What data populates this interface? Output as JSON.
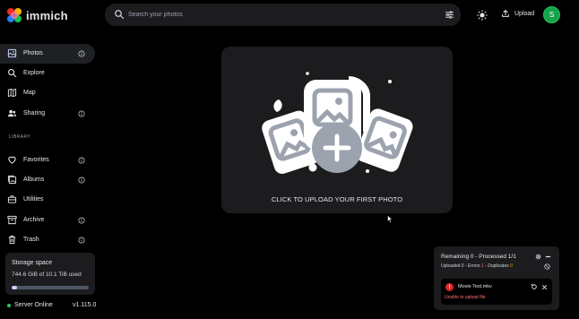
{
  "app": {
    "name": "immich"
  },
  "header": {
    "search_placeholder": "Search your photos",
    "upload_label": "Upload",
    "avatar_initial": "S"
  },
  "sidebar": {
    "items": [
      {
        "label": "Photos",
        "icon": "photos-icon",
        "active": true,
        "info": true
      },
      {
        "label": "Explore",
        "icon": "explore-icon",
        "active": false,
        "info": false
      },
      {
        "label": "Map",
        "icon": "map-icon",
        "active": false,
        "info": false
      },
      {
        "label": "Sharing",
        "icon": "sharing-icon",
        "active": false,
        "info": true
      }
    ],
    "library_label": "LIBRARY",
    "library_items": [
      {
        "label": "Favorites",
        "icon": "heart-icon",
        "info": true
      },
      {
        "label": "Albums",
        "icon": "albums-icon",
        "info": true
      },
      {
        "label": "Utilities",
        "icon": "utilities-icon",
        "info": false
      },
      {
        "label": "Archive",
        "icon": "archive-icon",
        "info": true
      },
      {
        "label": "Trash",
        "icon": "trash-icon",
        "info": true
      }
    ],
    "storage": {
      "title": "Storage space",
      "used_text": "744.6 GiB of 10.1 TiB used",
      "used_fraction": 0.072
    },
    "server": {
      "status": "Server Online",
      "version": "v1.115.0"
    }
  },
  "main": {
    "empty_text": "CLICK TO UPLOAD YOUR FIRST PHOTO"
  },
  "upload_panel": {
    "title": "Remaining 0 - Processed 1/1",
    "uploaded_label": "Uploaded 0 - Errors ",
    "errors_count": "1",
    "duplicates_label": " - Duplicates ",
    "duplicates_count": "0",
    "file": {
      "name": "Movie Test.mkv",
      "error": "Unable to upload file"
    }
  },
  "colors": {
    "background": "#000000",
    "surface": "#1c1c1e",
    "accent_avatar": "#16a34a",
    "error": "#f87171",
    "online": "#22c55e"
  }
}
